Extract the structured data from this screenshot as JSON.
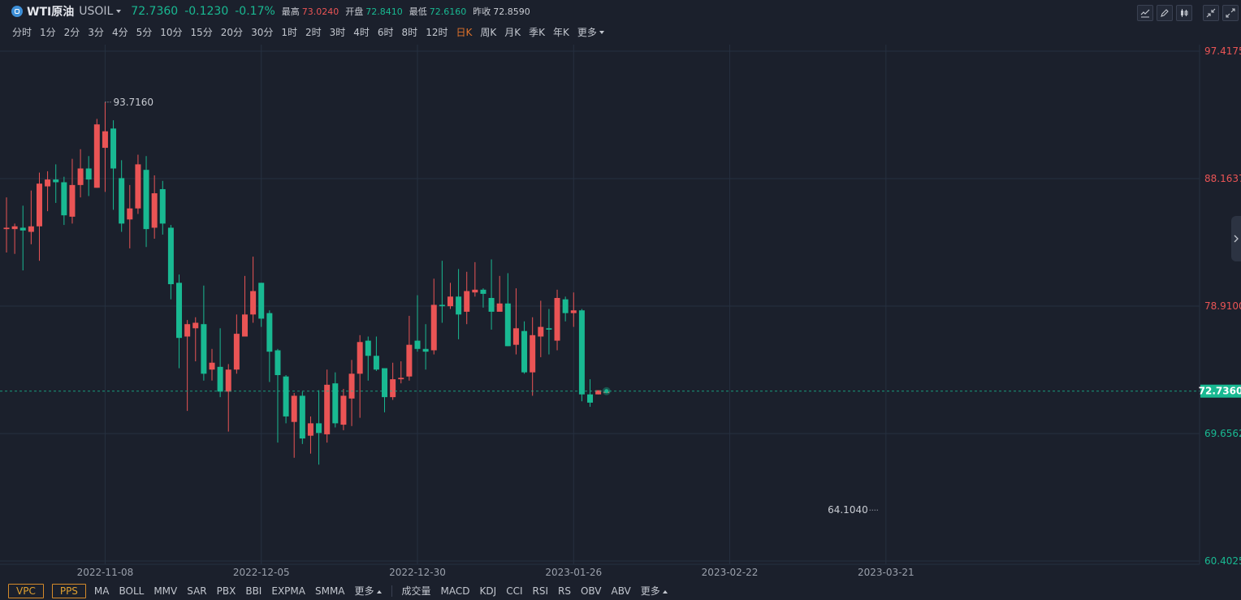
{
  "header": {
    "name": "WTI原油",
    "code": "USOIL",
    "price": "72.7360",
    "change": "-0.1230",
    "change_pct": "-0.17%",
    "stats": [
      {
        "label": "最高",
        "value": "73.0240",
        "tone": "red"
      },
      {
        "label": "开盘",
        "value": "72.8410",
        "tone": "green"
      },
      {
        "label": "最低",
        "value": "72.6160",
        "tone": "green"
      },
      {
        "label": "昨收",
        "value": "72.8590",
        "tone": "white"
      }
    ]
  },
  "periods": [
    "分时",
    "1分",
    "2分",
    "3分",
    "4分",
    "5分",
    "10分",
    "15分",
    "20分",
    "30分",
    "1时",
    "2时",
    "3时",
    "4时",
    "6时",
    "8时",
    "12时",
    "日K",
    "周K",
    "月K",
    "季K",
    "年K"
  ],
  "active_period": "日K",
  "more_label": "更多",
  "toolbar_icons": [
    "line-chart-icon",
    "pencil-icon",
    "candlestick-icon",
    "expand-icon"
  ],
  "indicators": {
    "boxed": [
      "VPC",
      "PPS"
    ],
    "main": [
      "MA",
      "BOLL",
      "MMV",
      "SAR",
      "PBX",
      "BBI",
      "EXPMA",
      "SMMA"
    ],
    "sub": [
      "成交量",
      "MACD",
      "KDJ",
      "CCI",
      "RSI",
      "RS",
      "OBV",
      "ABV"
    ],
    "more_label": "更多"
  },
  "colors": {
    "up": "#ea5455",
    "down": "#19b992",
    "background": "#1b202c",
    "grid": "#263040",
    "active": "#e0722b"
  },
  "chart_data": {
    "type": "candlestick",
    "y_axis_ticks": [
      "97.4175",
      "88.1637",
      "78.9100",
      "69.6562",
      "60.4025"
    ],
    "y_axis_colors": [
      "red",
      "red",
      "red",
      "green",
      "green"
    ],
    "ylim": [
      60.4025,
      97.4175
    ],
    "x_axis_ticks": [
      "2022-11-08",
      "2022-12-05",
      "2022-12-30",
      "2023-01-26",
      "2023-02-22",
      "2023-03-21"
    ],
    "x_tick_index": [
      12,
      31,
      50,
      69,
      88,
      107
    ],
    "high_label": "93.7160",
    "high_index": 12,
    "low_label": "64.1040",
    "low_index": 106,
    "last_price": "72.7360",
    "candles": [
      [
        84.5,
        84.6,
        86.8,
        82.8
      ],
      [
        84.5,
        84.7,
        84.9,
        82.7
      ],
      [
        84.6,
        84.4,
        86.2,
        81.5
      ],
      [
        84.3,
        84.7,
        87.3,
        83.4
      ],
      [
        84.7,
        87.8,
        88.6,
        82.2
      ],
      [
        87.6,
        88.1,
        88.7,
        85.8
      ],
      [
        88.1,
        87.9,
        89.2,
        86.4
      ],
      [
        87.9,
        85.5,
        88.3,
        84.8
      ],
      [
        85.4,
        87.7,
        89.6,
        84.9
      ],
      [
        87.7,
        88.9,
        90.3,
        86.8
      ],
      [
        88.9,
        88.1,
        89.8,
        86.9
      ],
      [
        87.5,
        92.1,
        92.5,
        87.5
      ],
      [
        90.4,
        91.6,
        93.7,
        87.2
      ],
      [
        91.8,
        88.9,
        92.4,
        85.9
      ],
      [
        88.2,
        84.9,
        89.5,
        84.3
      ],
      [
        85.2,
        86.0,
        87.7,
        83.1
      ],
      [
        86.0,
        89.2,
        89.9,
        85.6
      ],
      [
        88.8,
        84.5,
        89.8,
        83.2
      ],
      [
        84.6,
        87.1,
        88.4,
        83.8
      ],
      [
        87.4,
        84.9,
        88.0,
        84.1
      ],
      [
        84.6,
        80.5,
        84.8,
        79.4
      ],
      [
        80.6,
        76.6,
        81.2,
        74.4
      ],
      [
        76.7,
        77.6,
        77.9,
        71.3
      ],
      [
        77.3,
        77.7,
        78.1,
        74.9
      ],
      [
        77.6,
        74.0,
        80.4,
        73.5
      ],
      [
        74.3,
        74.8,
        75.8,
        73.5
      ],
      [
        74.5,
        72.7,
        77.3,
        72.3
      ],
      [
        72.7,
        74.3,
        74.7,
        69.8
      ],
      [
        74.3,
        76.9,
        78.3,
        74.0
      ],
      [
        76.7,
        78.3,
        81.1,
        76.9
      ],
      [
        78.3,
        80.0,
        82.5,
        77.7
      ],
      [
        80.6,
        78.0,
        80.6,
        77.4
      ],
      [
        78.4,
        75.6,
        78.6,
        73.4
      ],
      [
        75.7,
        73.9,
        75.8,
        69.0
      ],
      [
        73.8,
        70.9,
        73.9,
        70.4
      ],
      [
        70.5,
        72.4,
        72.6,
        67.9
      ],
      [
        72.4,
        69.3,
        72.7,
        68.9
      ],
      [
        69.5,
        70.4,
        70.9,
        68.2
      ],
      [
        70.4,
        69.7,
        72.8,
        67.4
      ],
      [
        69.6,
        73.2,
        74.3,
        69.0
      ],
      [
        73.3,
        70.4,
        74.1,
        70.1
      ],
      [
        70.3,
        72.4,
        72.9,
        69.9
      ],
      [
        72.2,
        74.0,
        75.0,
        70.2
      ],
      [
        74.0,
        76.3,
        76.8,
        70.8
      ],
      [
        76.4,
        75.3,
        76.7,
        73.5
      ],
      [
        75.3,
        74.3,
        76.7,
        74.2
      ],
      [
        74.4,
        72.3,
        74.4,
        71.2
      ],
      [
        72.3,
        73.6,
        74.8,
        72.1
      ],
      [
        73.6,
        73.7,
        74.9,
        73.3
      ],
      [
        73.8,
        76.1,
        78.2,
        73.5
      ],
      [
        76.4,
        75.8,
        79.7,
        75.6
      ],
      [
        75.8,
        75.6,
        77.6,
        74.3
      ],
      [
        75.7,
        79.0,
        80.9,
        75.4
      ],
      [
        79.0,
        78.9,
        82.2,
        77.7
      ],
      [
        78.9,
        79.6,
        80.6,
        78.7
      ],
      [
        79.6,
        78.3,
        81.6,
        76.5
      ],
      [
        78.5,
        80.0,
        81.4,
        77.6
      ],
      [
        79.9,
        80.1,
        82.1,
        79.6
      ],
      [
        80.1,
        79.8,
        80.2,
        78.8
      ],
      [
        79.5,
        78.5,
        82.3,
        77.2
      ],
      [
        78.5,
        79.1,
        81.1,
        78.7
      ],
      [
        79.1,
        76.0,
        81.3,
        76.0
      ],
      [
        76.1,
        77.3,
        80.2,
        75.4
      ],
      [
        77.1,
        74.1,
        77.8,
        74.0
      ],
      [
        74.1,
        76.8,
        78.1,
        72.4
      ],
      [
        76.7,
        77.4,
        79.3,
        75.2
      ],
      [
        77.3,
        77.2,
        78.7,
        75.4
      ],
      [
        76.4,
        79.5,
        80.1,
        75.7
      ],
      [
        79.4,
        78.4,
        79.6,
        77.8
      ],
      [
        78.4,
        78.6,
        79.9,
        77.4
      ],
      [
        78.6,
        72.5,
        78.7,
        72.0
      ],
      [
        72.5,
        71.9,
        73.6,
        71.6
      ],
      [
        72.5,
        72.8,
        72.7,
        72.5
      ],
      [
        72.6,
        72.7,
        72.8,
        72.6
      ]
    ]
  }
}
